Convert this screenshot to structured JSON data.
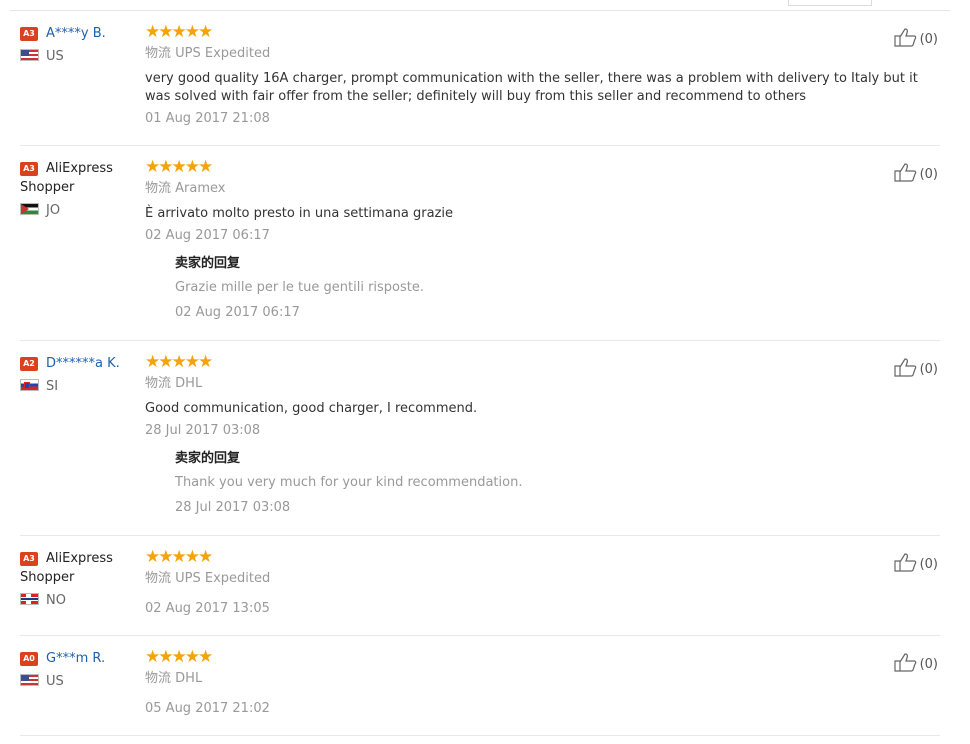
{
  "logistics_label": "物流",
  "reply_title": "卖家的回复",
  "rating_stars": "★★★★★",
  "colors": {
    "level_badge": "#d9411f",
    "star": "#f5a30b",
    "name_link": "#1f5fb0"
  },
  "reviews": [
    {
      "level": "A3",
      "name": "A****y B.",
      "name_line1": "",
      "name_line2": "",
      "flag": "us-flag-icon",
      "country": "US",
      "rating": 5,
      "logistics": "UPS Expedited",
      "text": "very good quality 16A charger, prompt communication with the seller, there was a problem with delivery to Italy but it was solved with fair offer from the seller; definitely will buy from this seller and recommend to others",
      "date": "01 Aug 2017 21:08",
      "likes": "(0)"
    },
    {
      "level": "A3",
      "name": "AliExpress Shopper",
      "name_line1": "AliExpress",
      "name_line2": "Shopper",
      "flag": "jo-flag-icon",
      "country": "JO",
      "rating": 5,
      "logistics": "Aramex",
      "text": "È arrivato molto presto in una settimana grazie",
      "date": "02 Aug 2017 06:17",
      "reply": {
        "text": "Grazie mille per le tue gentili risposte.",
        "date": "02 Aug 2017 06:17"
      },
      "likes": "(0)"
    },
    {
      "level": "A2",
      "name": "D******a K.",
      "flag": "si-flag-icon",
      "country": "SI",
      "rating": 5,
      "logistics": "DHL",
      "text": "Good communication, good charger, I recommend.",
      "date": "28 Jul 2017 03:08",
      "reply": {
        "text": "Thank you very much for your kind recommendation.",
        "date": "28 Jul 2017 03:08"
      },
      "likes": "(0)"
    },
    {
      "level": "A3",
      "name": "AliExpress Shopper",
      "name_line1": "AliExpress",
      "name_line2": "Shopper",
      "flag": "no-flag-icon",
      "country": "NO",
      "rating": 5,
      "logistics": "UPS Expedited",
      "date": "02 Aug 2017 13:05",
      "likes": "(0)"
    },
    {
      "level": "A0",
      "name": "G***m R.",
      "flag": "us-flag-icon",
      "country": "US",
      "rating": 5,
      "logistics": "DHL",
      "date": "05 Aug 2017 21:02",
      "likes": "(0)"
    }
  ]
}
